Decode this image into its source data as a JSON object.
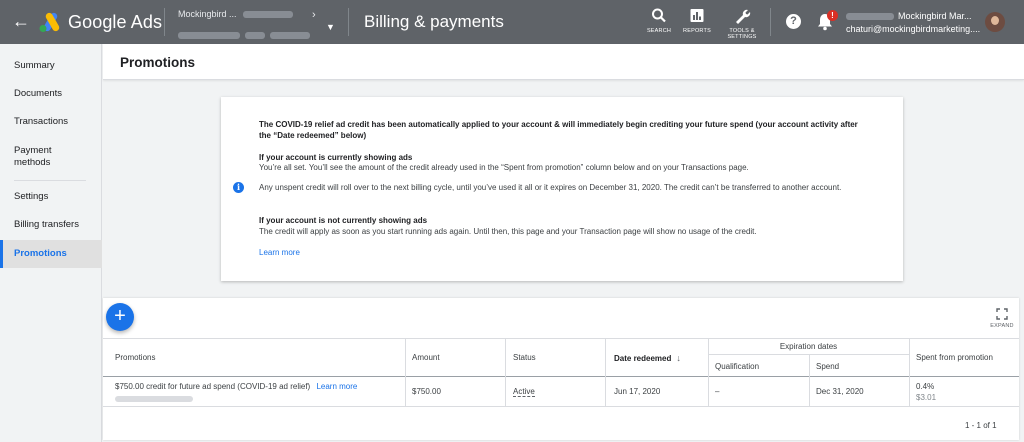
{
  "topbar": {
    "product": "Google Ads",
    "account_name": "Mockingbird ...",
    "page_title": "Billing & payments",
    "tools": [
      {
        "icon": "search-icon",
        "label": "SEARCH"
      },
      {
        "icon": "reports-icon",
        "label": "REPORTS"
      },
      {
        "icon": "wrench-icon",
        "label_line1": "TOOLS &",
        "label_line2": "SETTINGS"
      }
    ],
    "notification_badge": "!",
    "user_name": "Mockingbird Mar...",
    "user_email": "chaturi@mockingbirdmarketing...."
  },
  "sidebar": {
    "items": [
      {
        "label": "Summary"
      },
      {
        "label": "Documents"
      },
      {
        "label": "Transactions"
      },
      {
        "label_line1": "Payment",
        "label_line2": "methods"
      },
      {
        "label": "Settings"
      },
      {
        "label": "Billing transfers"
      },
      {
        "label": "Promotions"
      }
    ]
  },
  "main": {
    "title": "Promotions"
  },
  "notice": {
    "heading": "The COVID-19 relief ad credit has been automatically applied to your account & will immediately begin crediting your future spend (your account activity after the “Date redeemed” below)",
    "sub1_title": "If your account is currently showing ads",
    "sub1_body": "You’re all set. You’ll see the amount of the credit already used in the “Spent from promotion” column below and on your Transactions page.",
    "rollover": "Any unspent credit will roll over to the next billing cycle, until you’ve used it all or it expires on December 31, 2020. The credit can’t be transferred to another account.",
    "sub2_title": "If your account is not currently showing ads",
    "sub2_body": "The credit will apply as soon as you start running ads again. Until then, this page and your Transaction page will show no usage of the credit.",
    "learn_more": "Learn more"
  },
  "table": {
    "expand_label": "EXPAND",
    "headers": {
      "promotions": "Promotions",
      "amount": "Amount",
      "status": "Status",
      "date_redeemed": "Date redeemed",
      "expiration_dates": "Expiration dates",
      "qualification": "Qualification",
      "spend": "Spend",
      "spent_from_promotion": "Spent from promotion"
    },
    "rows": [
      {
        "promotion": "$750.00 credit for future ad spend (COVID-19 ad relief)",
        "learn_more": "Learn more",
        "amount": "$750.00",
        "status": "Active",
        "date_redeemed": "Jun 17, 2020",
        "qualification": "–",
        "spend": "Dec 31, 2020",
        "spent_pct": "0.4%",
        "spent_amount": "$3.01"
      }
    ],
    "pagination": "1 - 1 of 1"
  }
}
